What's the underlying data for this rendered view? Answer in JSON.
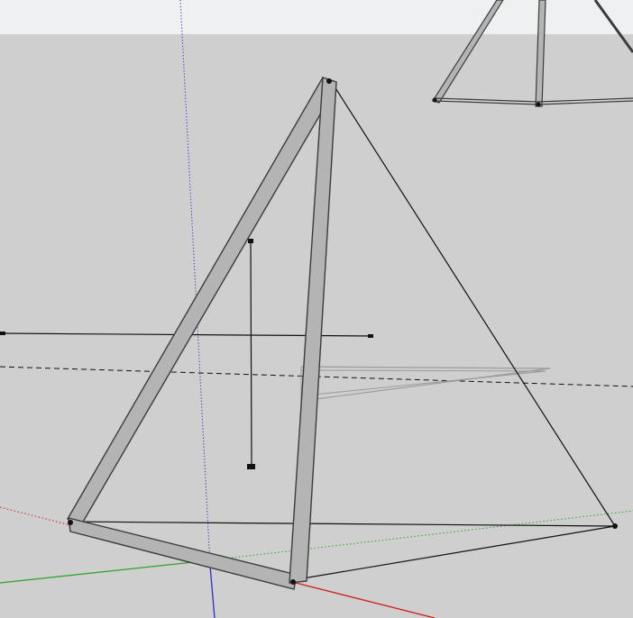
{
  "colors": {
    "sky": "#eef0f2",
    "ground": "#cfcfcf",
    "bar_face": "#b4b4b4",
    "bar_edge": "#3b3b3b",
    "edge_line": "#111111",
    "axis_red": "#d21b1b",
    "axis_green": "#2aa52a",
    "axis_blue": "#2b2bcc",
    "guide_dash": "#111111",
    "shadow_outline": "#9b9b9b"
  },
  "scene": {
    "axes": [
      "red-axis",
      "green-axis",
      "blue-axis"
    ],
    "objects": [
      "main-pyramid-frame",
      "background-pyramid-frame",
      "vertical-guide-line",
      "horizontal-guide-line",
      "dashed-inference-line",
      "ground-shadow-outline"
    ]
  }
}
